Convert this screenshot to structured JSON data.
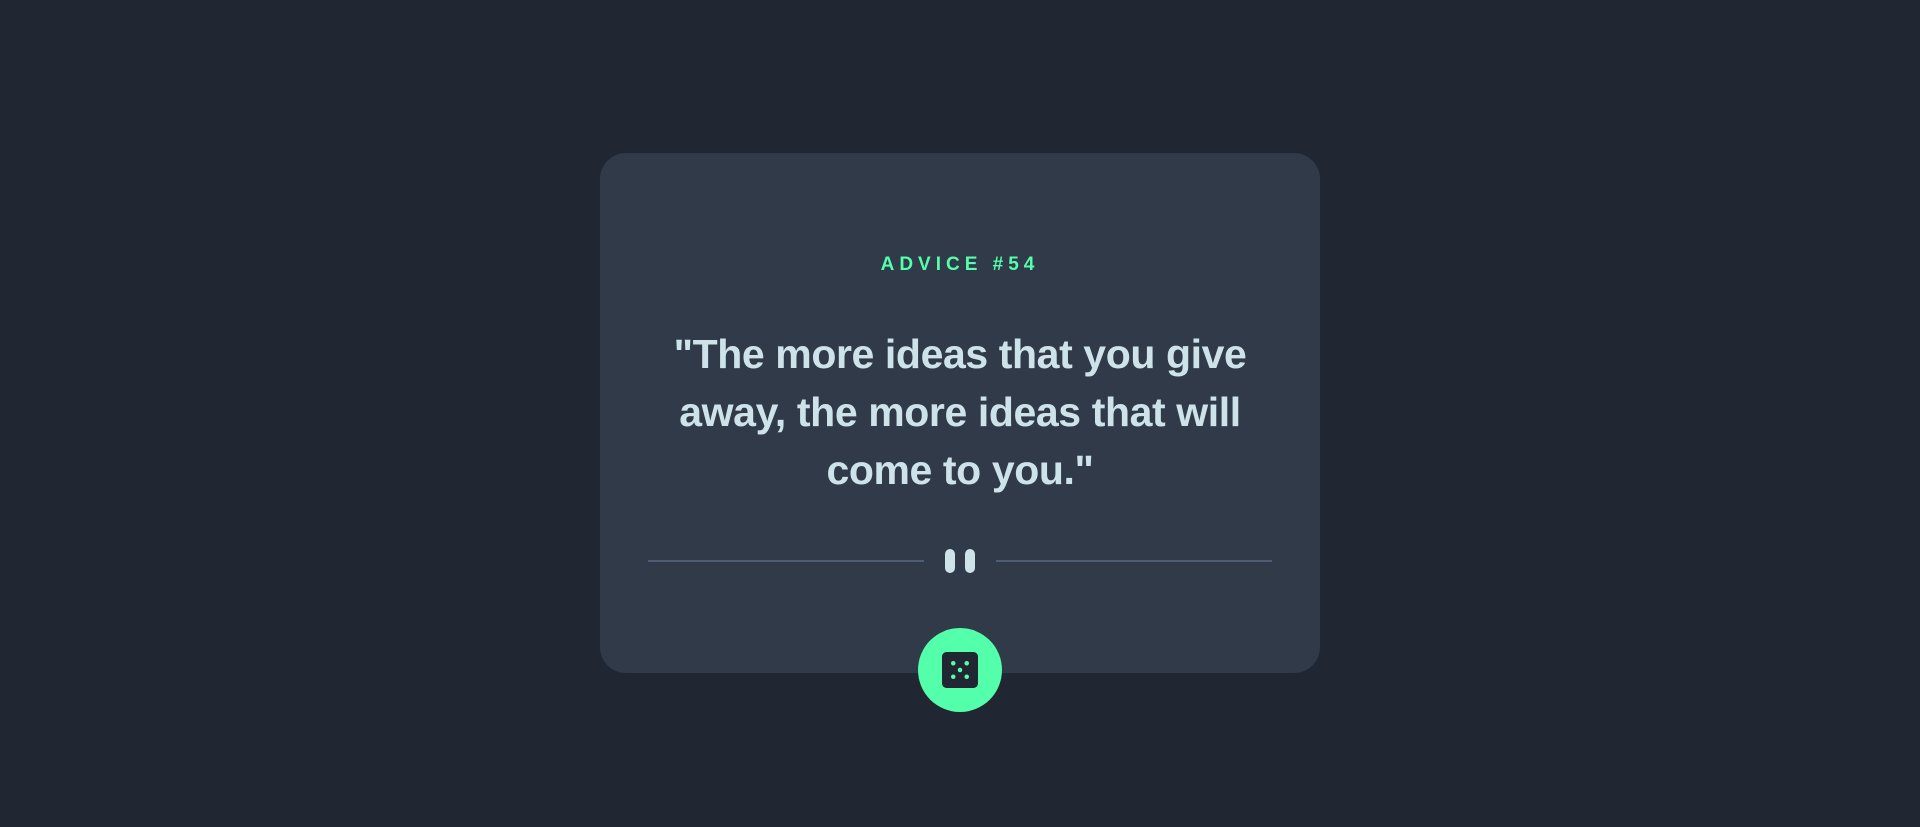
{
  "advice": {
    "id_label": "ADVICE #54",
    "quote": "\"The more ideas that you give away, the more ideas that will come to you.\""
  },
  "divider": {
    "icon": "pause-icon"
  },
  "dice_button": {
    "icon": "dice-icon"
  },
  "colors": {
    "background": "#202733",
    "card": "#313a49",
    "accent": "#53ffaa",
    "text": "#cee3e9",
    "divider": "#4f5d74"
  }
}
